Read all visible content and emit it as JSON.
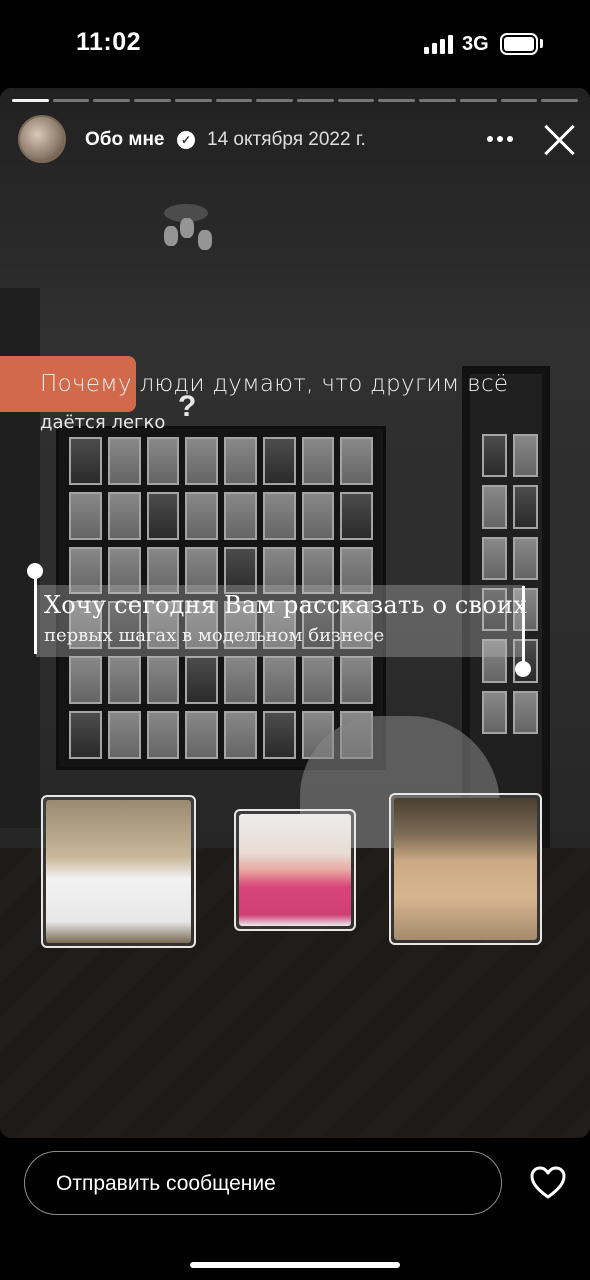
{
  "status_bar": {
    "time": "11:02",
    "network": "3G",
    "battery_level": 1.0
  },
  "story": {
    "progress": {
      "segments_total": 14,
      "segments_done": 1
    },
    "author": "Обо мне",
    "verified": true,
    "date": "14 октября 2022 г.",
    "question": {
      "highlight_word": "Почему",
      "line1_rest": " люди думают, что другим всё",
      "line2": "даётся легко",
      "mark": "?"
    },
    "textbox": {
      "line1": "Хочу сегодня Вам рассказать о своих",
      "line2": "первых шагах в модельном бизнесе"
    },
    "photos": [
      "runway-look-white-suit",
      "pink-trousers-look",
      "sheer-runway-dress"
    ],
    "accent_color": "#d2694a"
  },
  "footer": {
    "message_placeholder": "Отправить сообщение",
    "like_icon": "heart-icon"
  }
}
